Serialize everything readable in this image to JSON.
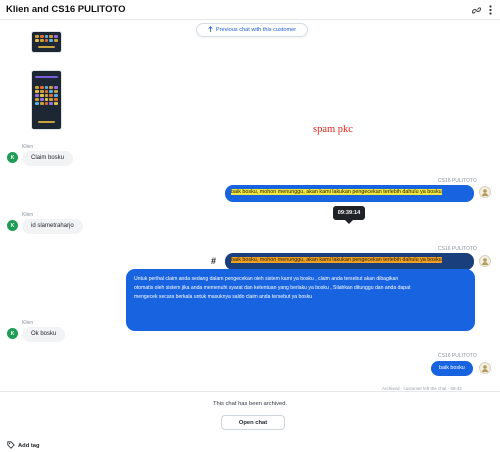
{
  "header": {
    "title": "Klien and CS16 PULITOTO",
    "link_icon": "link-icon",
    "more_icon": "more-vertical-icon"
  },
  "chat": {
    "previous_chat_label": "Previous chat with this customer",
    "annotation": "spam pkc",
    "tooltip_time": "09:39:14",
    "hash_mark": "#",
    "messages": [
      {
        "sender": "Klien",
        "avatar": "K",
        "text": "Claim bosku"
      },
      {
        "sender": "CS16 PULITOTO",
        "text": "baik bosku, mohon menunggu, akan kami lakukan pengecekan terlebih dahulu ya bosku"
      },
      {
        "sender": "Klien",
        "avatar": "K",
        "text": "id slametraharjo"
      },
      {
        "sender": "CS16 PULITOTO",
        "text": "baik bosku, mohon menunggu, akan kami lakukan pengecekan terlebih dahulu ya bosku"
      },
      {
        "sender": "",
        "lines": [
          "Untuk perihal claim anda sedang dalam pengecekan oleh sistem kami ya bosku , claim anda tersebut akan dibagikan",
          "otomatis oleh sistem jika anda memenuhi syarat dan ketentuan yang berlaku ya bosku , Silahkan ditunggu dan anda dapat",
          "mengecek secara berkala untuk masuknya saldo claim anda tersebut ya bosku"
        ]
      },
      {
        "sender": "Klien",
        "avatar": "K",
        "text": "Ok bosku"
      },
      {
        "sender": "CS16 PULITOTO",
        "text": "baik bosku"
      }
    ],
    "archived_meta": "Archived · customer left the chat · 09:42"
  },
  "footer": {
    "archived_text": "This chat has been archived.",
    "open_chat_label": "Open chat",
    "add_tag_label": "Add tag"
  },
  "colors": {
    "accent": "#1864e0",
    "client_avatar": "#1f9d57",
    "highlight_yellow": "#f3e83a",
    "highlight_orange": "#f0a020",
    "annotation_red": "#e0261c"
  }
}
